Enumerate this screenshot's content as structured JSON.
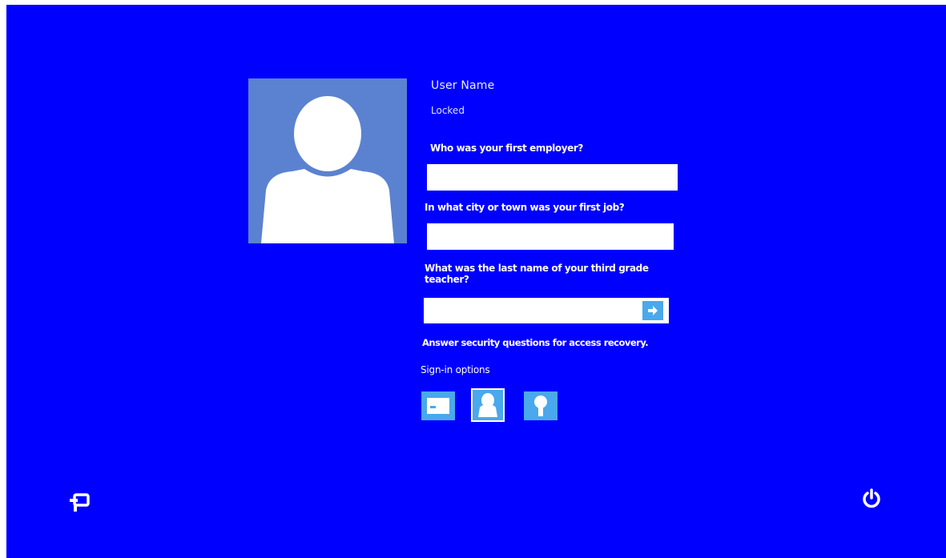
{
  "user": {
    "name": "User Name",
    "status": "Locked",
    "avatar_icon": "user-silhouette-icon"
  },
  "security_questions": [
    {
      "question": "Who was your first employer?",
      "answer": "",
      "placeholder": ""
    },
    {
      "question": "In what city or town was your first job?",
      "answer": "",
      "placeholder": ""
    },
    {
      "question": "What was the last name of your third grade teacher?",
      "answer": "",
      "placeholder": ""
    }
  ],
  "submit_icon": "arrow-right-icon",
  "hint": "Answer security questions for access recovery.",
  "sign_in_options": {
    "label": "Sign-in options",
    "options": [
      {
        "icon": "password-keyboard-icon",
        "selected": false
      },
      {
        "icon": "picture-password-icon",
        "selected": true
      },
      {
        "icon": "pin-key-icon",
        "selected": false
      }
    ]
  },
  "corner_icons": {
    "left": "ease-of-access-icon",
    "right": "power-icon"
  },
  "colors": {
    "background": "#0000ff",
    "avatar_tile": "#5b82d0",
    "accent": "#4aa8ec",
    "text": "#ffffff"
  }
}
